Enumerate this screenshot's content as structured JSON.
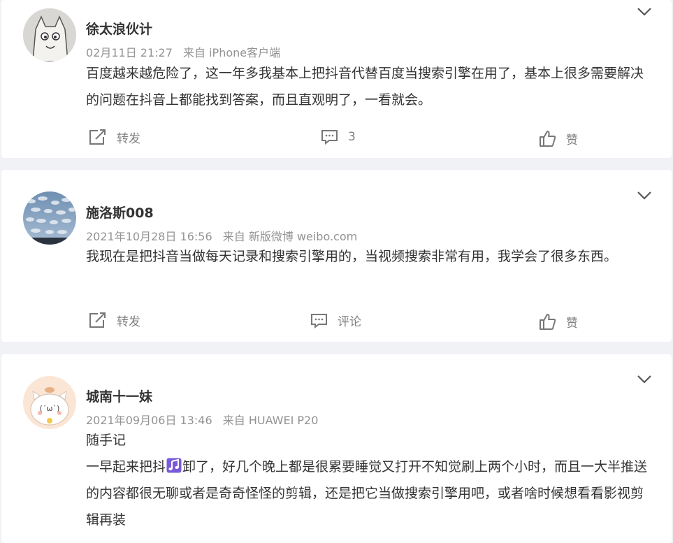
{
  "comments": [
    {
      "user": "徐太浪伙计",
      "time": "02月11日 21:27",
      "source": "来自 iPhone客户端",
      "text": "百度越来越危险了，这一年多我基本上把抖音代替百度当搜索引擎在用了，基本上很多需要解决的问题在抖音上都能找到答案，而且直观明了，一看就会。",
      "repost": "转发",
      "comment": "3",
      "like": "赞"
    },
    {
      "user": "施洛斯008",
      "time": "2021年10月28日 16:56",
      "source": "来自 新版微博 weibo.com",
      "text": "我现在是把抖音当做每天记录和搜索引擎用的，当视频搜索非常有用，我学会了很多东西。",
      "repost": "转发",
      "comment": "评论",
      "like": "赞"
    },
    {
      "user": "城南十一妹",
      "time": "2021年09月06日 13:46",
      "source": "来自 HUAWEI P20",
      "line1": "随手记",
      "text_a": "一早起来把抖",
      "emoji_icon": "music-note-emoji-icon",
      "text_b": "卸了，好几个晚上都是很累要睡觉又打开不知觉刷上两个小时，而且一大半推送的内容都很无聊或者是奇奇怪怪的剪辑，还是把它当做搜索引擎用吧，或者啥时候想看看影视剪辑再装"
    }
  ]
}
